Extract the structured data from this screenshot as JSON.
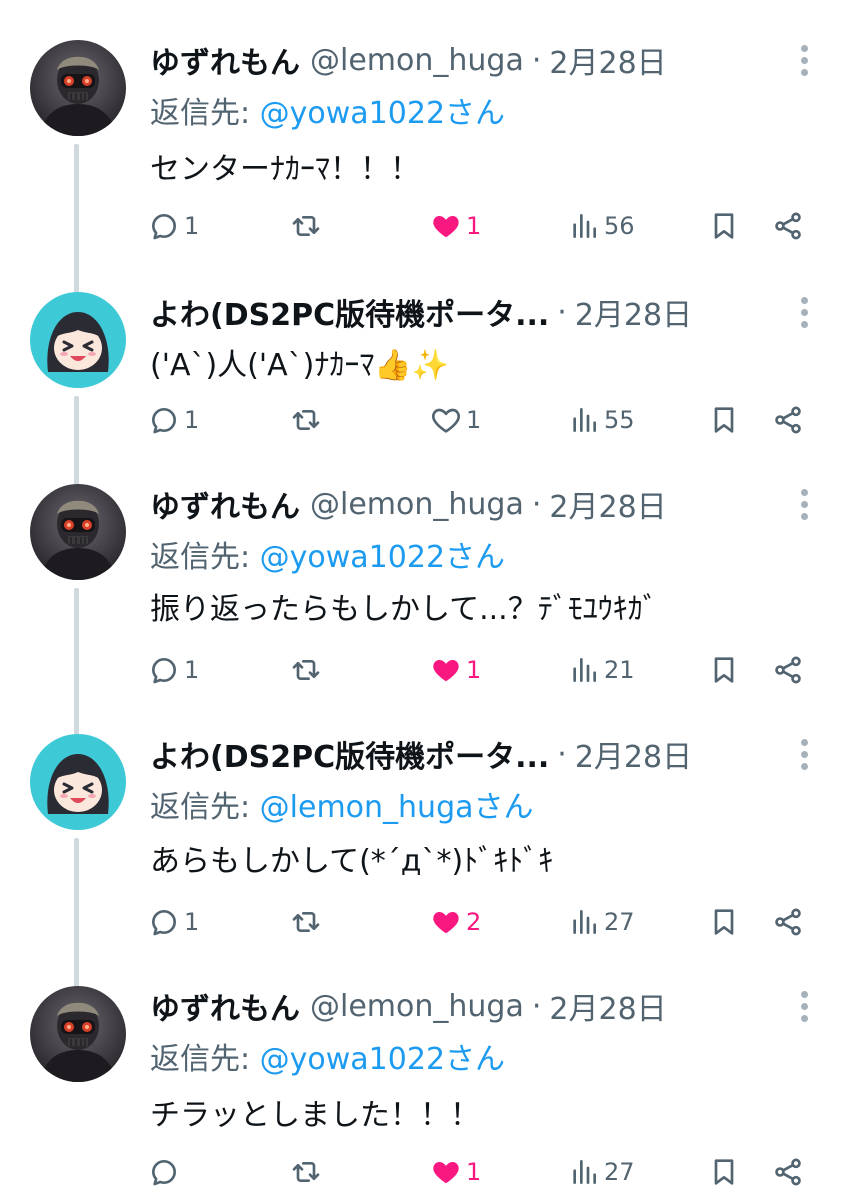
{
  "tweets": [
    {
      "name": "ゆずれもん",
      "handle": "@lemon_huga",
      "date": "2月28日",
      "reply_label": "返信先:",
      "reply_mention": "@yowa1022さん",
      "text": "センターﾅｶｰﾏ！！！",
      "replies": "1",
      "retweets": "",
      "likes": "1",
      "liked": true,
      "views": "56",
      "avatar": "masked-person"
    },
    {
      "name": "よわ(DS2PC版待機ポータ...",
      "handle": "",
      "date": "2月28日",
      "reply_label": "",
      "reply_mention": "",
      "text": "('A`)人('A`)ﾅｶｰﾏ👍✨",
      "replies": "1",
      "retweets": "",
      "likes": "1",
      "liked": false,
      "views": "55",
      "avatar": "anime-girl"
    },
    {
      "name": "ゆずれもん",
      "handle": "@lemon_huga",
      "date": "2月28日",
      "reply_label": "返信先:",
      "reply_mention": "@yowa1022さん",
      "text": "振り返ったらもしかして...？ﾃﾞﾓﾕｳｷｶﾞ",
      "replies": "1",
      "retweets": "",
      "likes": "1",
      "liked": true,
      "views": "21",
      "avatar": "masked-person"
    },
    {
      "name": "よわ(DS2PC版待機ポータ...",
      "handle": "",
      "date": "2月28日",
      "reply_label": "返信先:",
      "reply_mention": "@lemon_hugaさん",
      "text": "あらもしかして(*´д`*)ﾄﾞｷﾄﾞｷ",
      "replies": "1",
      "retweets": "",
      "likes": "2",
      "liked": true,
      "views": "27",
      "avatar": "anime-girl"
    },
    {
      "name": "ゆずれもん",
      "handle": "@lemon_huga",
      "date": "2月28日",
      "reply_label": "返信先:",
      "reply_mention": "@yowa1022さん",
      "text": "チラッとしました！！！",
      "replies": "",
      "retweets": "",
      "likes": "1",
      "liked": true,
      "views": "27",
      "avatar": "masked-person"
    }
  ],
  "icons": {
    "reply": "speech-bubble-icon",
    "retweet": "retweet-arrows-icon",
    "like": "heart-icon",
    "views": "bar-chart-icon",
    "bookmark": "bookmark-icon",
    "share": "share-icon",
    "more": "vertical-dots-icon"
  },
  "colors": {
    "like_active": "#f91880",
    "mention": "#1d9bf0",
    "muted": "#536471",
    "thread_line": "#cfd9de",
    "anime_avatar_bg": "#3ec9d6"
  }
}
